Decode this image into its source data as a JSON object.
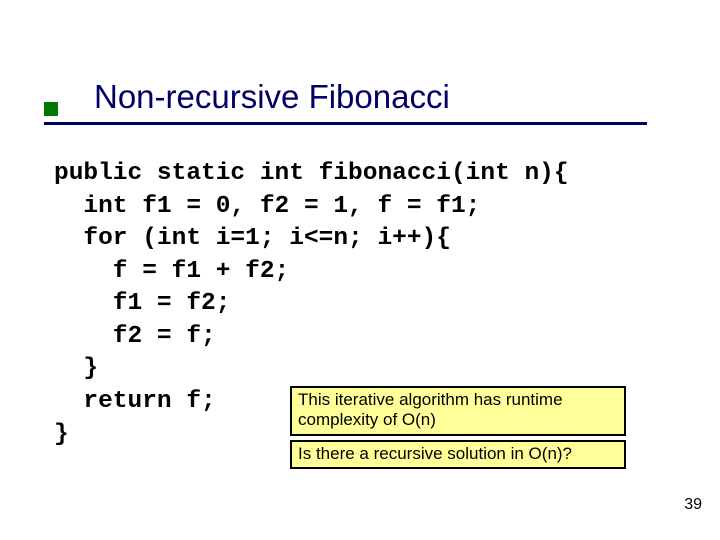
{
  "title": "Non-recursive Fibonacci",
  "code": "public static int fibonacci(int n){\n  int f1 = 0, f2 = 1, f = f1;\n  for (int i=1; i<=n; i++){\n    f = f1 + f2;\n    f1 = f2;\n    f2 = f;\n  }\n  return f;\n}",
  "note1": "This iterative algorithm has runtime complexity of O(n)",
  "note2": "Is there a recursive solution in O(n)?",
  "page_number": "39"
}
